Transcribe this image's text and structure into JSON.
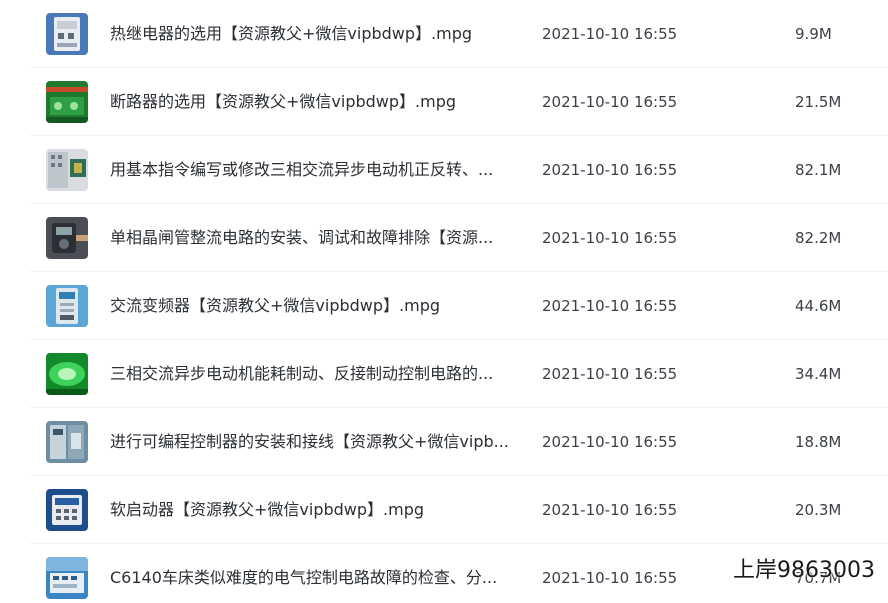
{
  "files": [
    {
      "name": "热继电器的选用【资源教父+微信vipbdwp】.mpg",
      "date": "2021-10-10 16:55",
      "size": "9.9M",
      "thumb_icon": "relay-thumbnail-icon"
    },
    {
      "name": "断路器的选用【资源教父+微信vipbdwp】.mpg",
      "date": "2021-10-10 16:55",
      "size": "21.5M",
      "thumb_icon": "circuit-breaker-thumbnail-icon"
    },
    {
      "name": "用基本指令编写或修改三相交流异步电动机正反转、...",
      "date": "2021-10-10 16:55",
      "size": "82.1M",
      "thumb_icon": "plc-panel-thumbnail-icon"
    },
    {
      "name": "单相晶闸管整流电路的安装、调试和故障排除【资源...",
      "date": "2021-10-10 16:55",
      "size": "82.2M",
      "thumb_icon": "multimeter-thumbnail-icon"
    },
    {
      "name": "交流变频器【资源教父+微信vipbdwp】.mpg",
      "date": "2021-10-10 16:55",
      "size": "44.6M",
      "thumb_icon": "inverter-thumbnail-icon"
    },
    {
      "name": "三相交流异步电动机能耗制动、反接制动控制电路的...",
      "date": "2021-10-10 16:55",
      "size": "34.4M",
      "thumb_icon": "circuit-board-thumbnail-icon"
    },
    {
      "name": "进行可编程控制器的安装和接线【资源教父+微信vipb...",
      "date": "2021-10-10 16:55",
      "size": "18.8M",
      "thumb_icon": "cabinet-thumbnail-icon"
    },
    {
      "name": "软启动器【资源教父+微信vipbdwp】.mpg",
      "date": "2021-10-10 16:55",
      "size": "20.3M",
      "thumb_icon": "soft-starter-thumbnail-icon"
    },
    {
      "name": "C6140车床类似难度的电气控制电路故障的检查、分...",
      "date": "2021-10-10 16:55",
      "size": "70.7M",
      "thumb_icon": "lathe-panel-thumbnail-icon"
    }
  ],
  "watermark": "上岸9863003"
}
